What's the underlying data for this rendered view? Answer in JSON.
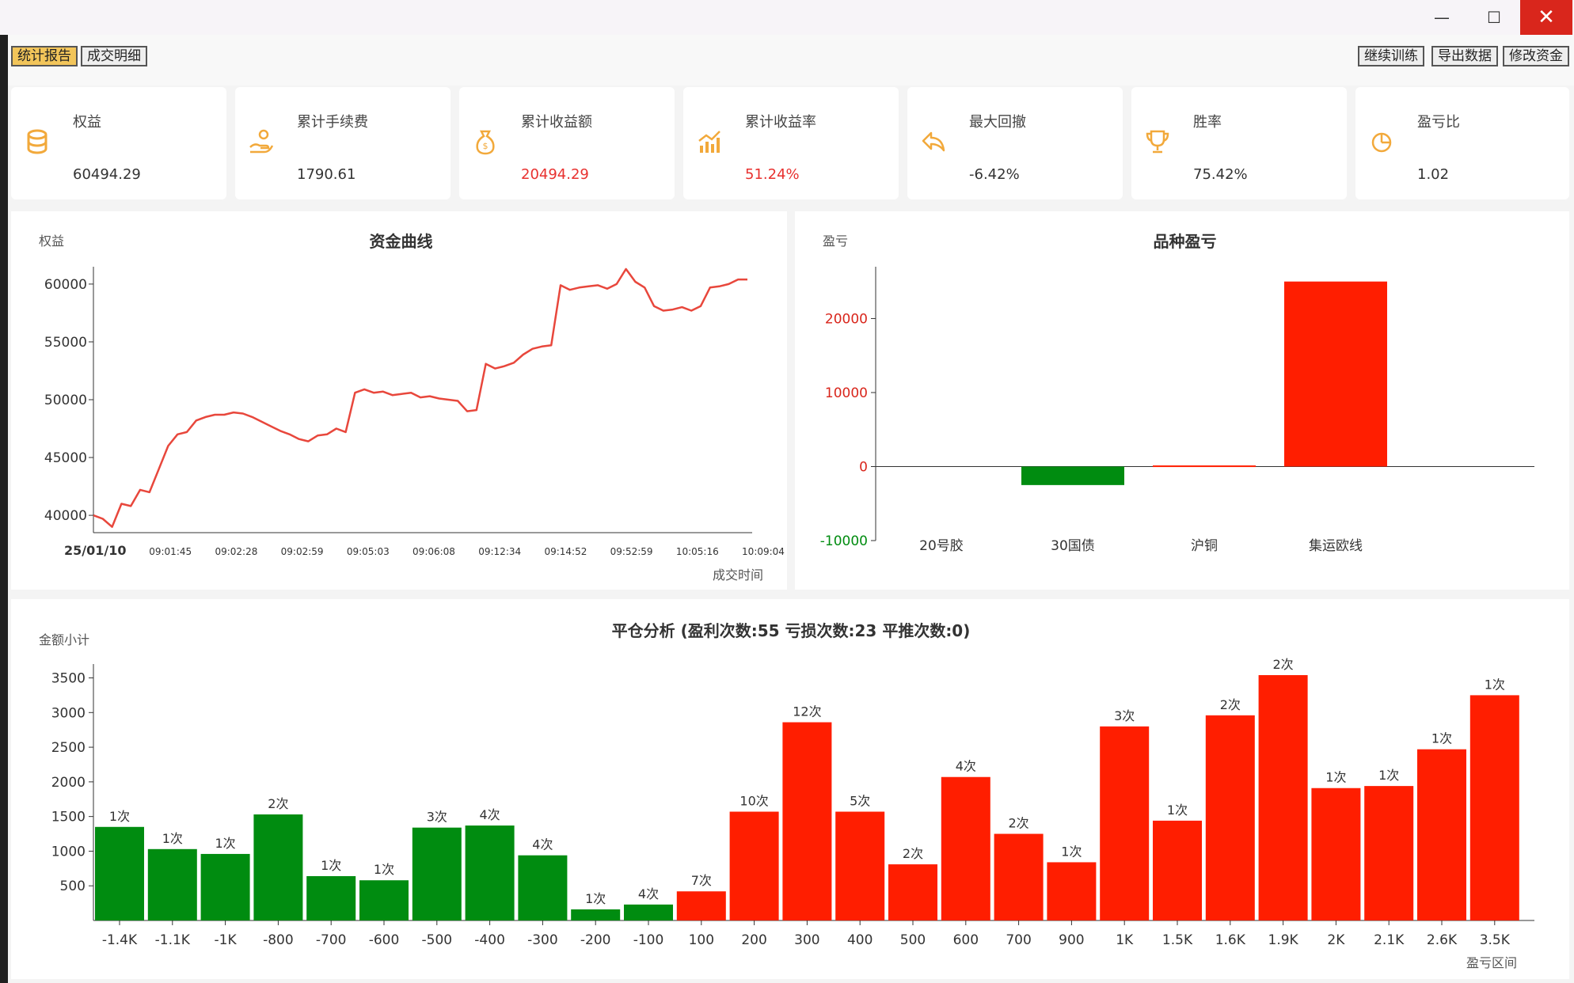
{
  "window": {
    "min_glyph": "—",
    "max_glyph": "☐",
    "close_glyph": "✕"
  },
  "tabs": [
    {
      "label": "统计报告",
      "active": true
    },
    {
      "label": "成交明细",
      "active": false
    }
  ],
  "toolbar": {
    "continue_label": "继续训练",
    "export_label": "导出数据",
    "modify_label": "修改资金"
  },
  "stats": [
    {
      "label": "权益",
      "value": "60494.29",
      "icon": "database-icon",
      "highlight": false
    },
    {
      "label": "累计手续费",
      "value": "1790.61",
      "icon": "hand-coins-icon",
      "highlight": false
    },
    {
      "label": "累计收益额",
      "value": "20494.29",
      "icon": "money-bag-icon",
      "highlight": true
    },
    {
      "label": "累计收益率",
      "value": "51.24%",
      "icon": "growth-chart-icon",
      "highlight": true
    },
    {
      "label": "最大回撤",
      "value": "-6.42%",
      "icon": "undo-arrow-icon",
      "highlight": false
    },
    {
      "label": "胜率",
      "value": "75.42%",
      "icon": "trophy-icon",
      "highlight": false
    },
    {
      "label": "盈亏比",
      "value": "1.02",
      "icon": "pie-icon",
      "highlight": false
    }
  ],
  "colors": {
    "accent": "#f2a93b",
    "profit": "#ff1e00",
    "loss": "#008c10",
    "line": "#e8473c"
  },
  "chart_data": [
    {
      "type": "line",
      "title": "资金曲线",
      "ylabel": "权益",
      "xlabel": "成交时间",
      "ylim": [
        38500,
        61500
      ],
      "yticks": [
        40000,
        45000,
        50000,
        55000,
        60000
      ],
      "xticks": [
        "25/01/10",
        "09:01:45",
        "09:02:28",
        "09:02:59",
        "09:05:03",
        "09:06:08",
        "09:12:34",
        "09:14:52",
        "09:52:59",
        "10:05:16",
        "10:09:04"
      ],
      "values": [
        40000,
        39700,
        39000,
        41000,
        40800,
        42200,
        42000,
        44000,
        46000,
        47000,
        47200,
        48200,
        48500,
        48700,
        48700,
        48900,
        48800,
        48500,
        48100,
        47700,
        47300,
        47000,
        46600,
        46400,
        46900,
        47000,
        47500,
        47200,
        50600,
        50900,
        50600,
        50700,
        50400,
        50500,
        50600,
        50200,
        50300,
        50100,
        50000,
        49900,
        49000,
        49100,
        53100,
        52700,
        52900,
        53200,
        53900,
        54400,
        54600,
        54700,
        59900,
        59500,
        59700,
        59800,
        59900,
        59600,
        60000,
        61300,
        60200,
        59700,
        58100,
        57700,
        57800,
        58000,
        57700,
        58100,
        59700,
        59800,
        60000,
        60400,
        60400
      ]
    },
    {
      "type": "bar",
      "title": "品种盈亏",
      "ylabel": "盈亏",
      "ylim": [
        -10000,
        27000
      ],
      "yticks": [
        -10000,
        0,
        10000,
        20000
      ],
      "categories": [
        "20号胶",
        "30国债",
        "沪铜",
        "集运欧线"
      ],
      "values": [
        0,
        -2500,
        150,
        25000
      ]
    },
    {
      "type": "bar",
      "title": "平仓分析 (盈利次数:55 亏损次数:23 平推次数:0)",
      "ylabel": "金额小计",
      "xlabel": "盈亏区间",
      "ylim": [
        0,
        3700
      ],
      "yticks": [
        500,
        1000,
        1500,
        2000,
        2500,
        3000,
        3500
      ],
      "categories": [
        "-1.4K",
        "-1.1K",
        "-1K",
        "-800",
        "-700",
        "-600",
        "-500",
        "-400",
        "-300",
        "-200",
        "-100",
        "100",
        "200",
        "300",
        "400",
        "500",
        "600",
        "700",
        "900",
        "1K",
        "1.5K",
        "1.6K",
        "1.9K",
        "2K",
        "2.1K",
        "2.6K",
        "3.5K"
      ],
      "values": [
        1350,
        1030,
        960,
        1530,
        640,
        580,
        1340,
        1370,
        940,
        160,
        230,
        420,
        1570,
        2860,
        1570,
        810,
        2070,
        1250,
        840,
        2800,
        1440,
        2960,
        3540,
        1910,
        1940,
        2470,
        3250
      ],
      "labels": [
        "1次",
        "1次",
        "1次",
        "2次",
        "1次",
        "1次",
        "3次",
        "4次",
        "4次",
        "1次",
        "4次",
        "7次",
        "10次",
        "12次",
        "5次",
        "2次",
        "4次",
        "2次",
        "1次",
        "3次",
        "1次",
        "2次",
        "2次",
        "1次",
        "1次",
        "1次",
        "1次"
      ]
    }
  ]
}
